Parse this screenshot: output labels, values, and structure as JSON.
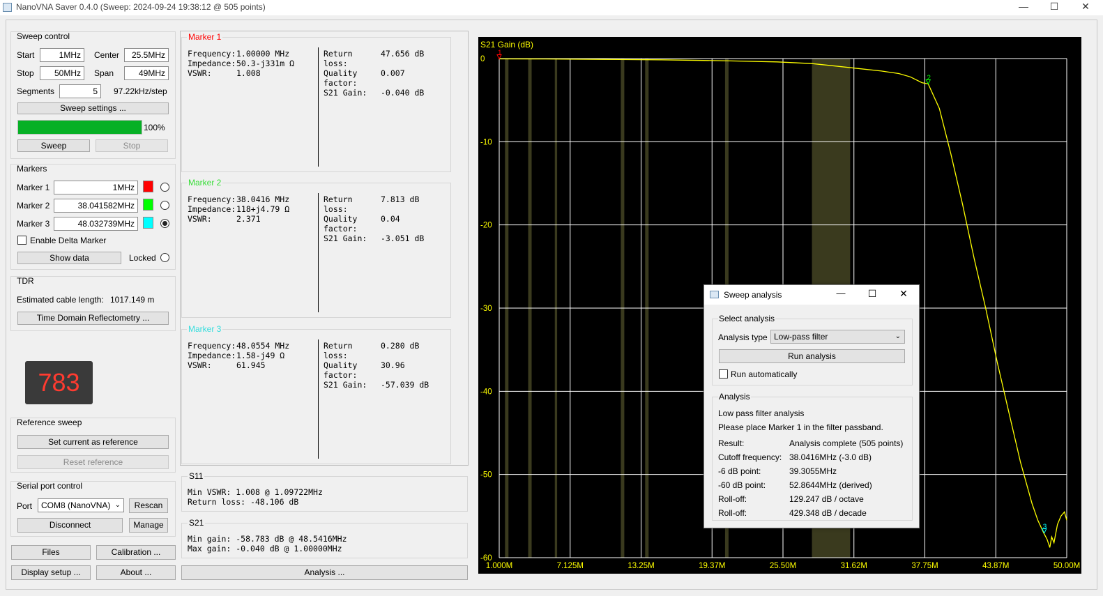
{
  "window": {
    "title": "NanoVNA Saver 0.4.0 (Sweep: 2024-09-24 19:38:12 @ 505 points)",
    "minimize": "—",
    "maximize": "☐",
    "close": "✕"
  },
  "sweep": {
    "group": "Sweep control",
    "start_label": "Start",
    "start_value": "1MHz",
    "center_label": "Center",
    "center_value": "25.5MHz",
    "stop_label": "Stop",
    "stop_value": "50MHz",
    "span_label": "Span",
    "span_value": "49MHz",
    "segments_label": "Segments",
    "segments_value": "5",
    "step_text": "97.22kHz/step",
    "settings_button": "Sweep settings ...",
    "progress": 100,
    "progress_text": "100%",
    "sweep_button": "Sweep",
    "stop_button": "Stop"
  },
  "markers": {
    "group": "Markers",
    "items": [
      {
        "label": "Marker 1",
        "value": "1MHz",
        "color": "#ff0000"
      },
      {
        "label": "Marker 2",
        "value": "38.041582MHz",
        "color": "#00ff00"
      },
      {
        "label": "Marker 3",
        "value": "48.032739MHz",
        "color": "#00ffff"
      }
    ],
    "delta_label": "Enable Delta Marker",
    "show_data_button": "Show data",
    "locked_label": "Locked"
  },
  "tdr": {
    "group": "TDR",
    "cable_label": "Estimated cable length:",
    "cable_value": "1017.149 m",
    "button": "Time Domain Reflectometry ..."
  },
  "counter": {
    "value": "783"
  },
  "reference": {
    "group": "Reference sweep",
    "set_button": "Set current as reference",
    "reset_button": "Reset reference"
  },
  "serial": {
    "group": "Serial port control",
    "port_label": "Port",
    "port_value": "COM8 (NanoVNA)",
    "rescan_button": "Rescan",
    "disconnect_button": "Disconnect",
    "manage_button": "Manage"
  },
  "bottom_buttons": {
    "files": "Files",
    "calibration": "Calibration ...",
    "display": "Display setup ...",
    "about": "About ...",
    "analysis": "Analysis ..."
  },
  "marker_panels": [
    {
      "title": "Marker 1",
      "color": "#ff0000",
      "left": [
        [
          "Frequency:",
          "1.00000 MHz"
        ],
        [
          "Impedance:",
          "50.3-j331m Ω"
        ],
        [
          "VSWR:",
          "1.008"
        ]
      ],
      "right": [
        [
          "Return loss:",
          "47.656 dB"
        ],
        [
          "Quality factor:",
          "0.007"
        ],
        [
          "S21 Gain:",
          "-0.040 dB"
        ]
      ]
    },
    {
      "title": "Marker 2",
      "color": "#33dd33",
      "left": [
        [
          "Frequency:",
          "38.0416 MHz"
        ],
        [
          "Impedance:",
          "118+j4.79 Ω"
        ],
        [
          "VSWR:",
          "2.371"
        ]
      ],
      "right": [
        [
          "Return loss:",
          "7.813 dB"
        ],
        [
          "Quality factor:",
          "0.04"
        ],
        [
          "S21 Gain:",
          "-3.051 dB"
        ]
      ]
    },
    {
      "title": "Marker 3",
      "color": "#33dddd",
      "left": [
        [
          "Frequency:",
          "48.0554 MHz"
        ],
        [
          "Impedance:",
          "1.58-j49 Ω"
        ],
        [
          "VSWR:",
          "61.945"
        ]
      ],
      "right": [
        [
          "Return loss:",
          "0.280 dB"
        ],
        [
          "Quality factor:",
          "30.96"
        ],
        [
          "S21 Gain:",
          "-57.039 dB"
        ]
      ]
    }
  ],
  "s11": {
    "title": "S11",
    "min_vswr_label": "Min VSWR:",
    "min_vswr_value": "1.008 @ 1.09722MHz",
    "return_loss_label": "Return loss:",
    "return_loss_value": "-48.106 dB"
  },
  "s21": {
    "title": "S21",
    "min_gain_label": "Min gain:",
    "min_gain_value": "-58.783 dB @ 48.5416MHz",
    "max_gain_label": "Max gain:",
    "max_gain_value": "-0.040 dB @ 1.00000MHz"
  },
  "dialog": {
    "title": "Sweep analysis",
    "select_group": "Select analysis",
    "type_label": "Analysis type",
    "type_value": "Low-pass filter",
    "run_button": "Run analysis",
    "auto_label": "Run automatically",
    "analysis_group": "Analysis",
    "heading": "Low pass filter analysis",
    "note": "Please place Marker 1 in the filter passband.",
    "rows": [
      [
        "Result:",
        "Analysis complete (505 points)"
      ],
      [
        "Cutoff frequency:",
        "38.0416MHz (-3.0 dB)"
      ],
      [
        "-6 dB point:",
        "39.3055MHz"
      ],
      [
        "-60 dB point:",
        "52.8644MHz (derived)"
      ],
      [
        "Roll-off:",
        "129.247 dB / octave"
      ],
      [
        "Roll-off:",
        "429.348 dB / decade"
      ]
    ]
  },
  "chart_data": {
    "type": "line",
    "title": "S21 Gain (dB)",
    "x_unit": "MHz",
    "xlim": [
      1.0,
      50.0
    ],
    "ylim": [
      -60,
      0
    ],
    "x_tick_labels": [
      "1.000M",
      "7.125M",
      "13.25M",
      "19.37M",
      "25.50M",
      "31.62M",
      "37.75M",
      "43.87M",
      "50.00M"
    ],
    "y_tick_labels": [
      "0",
      "-10",
      "-20",
      "-30",
      "-40",
      "-50",
      "-60"
    ],
    "grid": true,
    "background": "#000000",
    "trace_color": "#ffff00",
    "series": [
      {
        "x": [
          1.0,
          5.0,
          10.0,
          15.0,
          20.0,
          25.0,
          28.0,
          30.0,
          32.0,
          34.0,
          35.5,
          36.5,
          37.5,
          38.04,
          39.0,
          40.0,
          41.0,
          42.0,
          43.0,
          44.0,
          45.0,
          46.0,
          47.0,
          47.5,
          48.0,
          48.3,
          48.54,
          48.7,
          48.9,
          49.2,
          49.5,
          49.8,
          50.0
        ],
        "y": [
          -0.04,
          -0.05,
          -0.1,
          -0.15,
          -0.25,
          -0.4,
          -0.6,
          -0.9,
          -1.2,
          -1.5,
          -1.8,
          -2.2,
          -2.9,
          -3.05,
          -6.0,
          -11.5,
          -17.5,
          -24.0,
          -30.0,
          -36.5,
          -42.5,
          -48.5,
          -53.5,
          -55.5,
          -57.0,
          -57.8,
          -58.78,
          -57.5,
          -58.2,
          -56.0,
          -55.0,
          -54.5,
          -55.5
        ]
      }
    ],
    "markers": [
      {
        "label": "1",
        "x": 1.0,
        "y": -0.04,
        "color": "#ff0000"
      },
      {
        "label": "2",
        "x": 38.04,
        "y": -3.05,
        "color": "#00ff00"
      },
      {
        "label": "3",
        "x": 48.06,
        "y": -57.04,
        "color": "#00ffff"
      }
    ],
    "highlight_bands": [
      {
        "x0": 1.5,
        "x1": 1.8
      },
      {
        "x0": 3.5,
        "x1": 3.8
      },
      {
        "x0": 5.8,
        "x1": 6.0
      },
      {
        "x0": 11.5,
        "x1": 11.8
      },
      {
        "x0": 13.6,
        "x1": 13.9
      },
      {
        "x0": 20.5,
        "x1": 20.8
      },
      {
        "x0": 28.0,
        "x1": 31.3
      }
    ]
  }
}
